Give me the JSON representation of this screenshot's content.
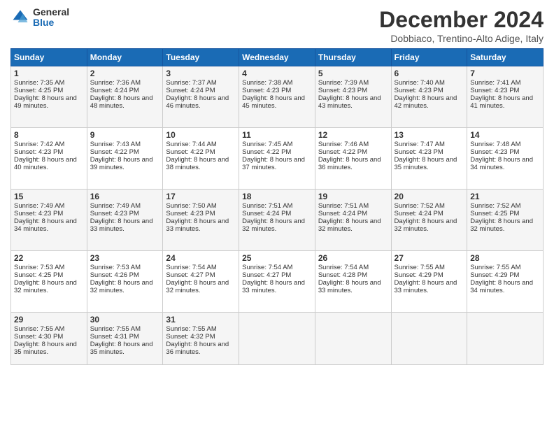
{
  "logo": {
    "general": "General",
    "blue": "Blue"
  },
  "title": "December 2024",
  "location": "Dobbiaco, Trentino-Alto Adige, Italy",
  "weekdays": [
    "Sunday",
    "Monday",
    "Tuesday",
    "Wednesday",
    "Thursday",
    "Friday",
    "Saturday"
  ],
  "weeks": [
    [
      {
        "day": "1",
        "sunrise": "7:35 AM",
        "sunset": "4:25 PM",
        "daylight": "8 hours and 49 minutes."
      },
      {
        "day": "2",
        "sunrise": "7:36 AM",
        "sunset": "4:24 PM",
        "daylight": "8 hours and 48 minutes."
      },
      {
        "day": "3",
        "sunrise": "7:37 AM",
        "sunset": "4:24 PM",
        "daylight": "8 hours and 46 minutes."
      },
      {
        "day": "4",
        "sunrise": "7:38 AM",
        "sunset": "4:23 PM",
        "daylight": "8 hours and 45 minutes."
      },
      {
        "day": "5",
        "sunrise": "7:39 AM",
        "sunset": "4:23 PM",
        "daylight": "8 hours and 43 minutes."
      },
      {
        "day": "6",
        "sunrise": "7:40 AM",
        "sunset": "4:23 PM",
        "daylight": "8 hours and 42 minutes."
      },
      {
        "day": "7",
        "sunrise": "7:41 AM",
        "sunset": "4:23 PM",
        "daylight": "8 hours and 41 minutes."
      }
    ],
    [
      {
        "day": "8",
        "sunrise": "7:42 AM",
        "sunset": "4:23 PM",
        "daylight": "8 hours and 40 minutes."
      },
      {
        "day": "9",
        "sunrise": "7:43 AM",
        "sunset": "4:22 PM",
        "daylight": "8 hours and 39 minutes."
      },
      {
        "day": "10",
        "sunrise": "7:44 AM",
        "sunset": "4:22 PM",
        "daylight": "8 hours and 38 minutes."
      },
      {
        "day": "11",
        "sunrise": "7:45 AM",
        "sunset": "4:22 PM",
        "daylight": "8 hours and 37 minutes."
      },
      {
        "day": "12",
        "sunrise": "7:46 AM",
        "sunset": "4:22 PM",
        "daylight": "8 hours and 36 minutes."
      },
      {
        "day": "13",
        "sunrise": "7:47 AM",
        "sunset": "4:23 PM",
        "daylight": "8 hours and 35 minutes."
      },
      {
        "day": "14",
        "sunrise": "7:48 AM",
        "sunset": "4:23 PM",
        "daylight": "8 hours and 34 minutes."
      }
    ],
    [
      {
        "day": "15",
        "sunrise": "7:49 AM",
        "sunset": "4:23 PM",
        "daylight": "8 hours and 34 minutes."
      },
      {
        "day": "16",
        "sunrise": "7:49 AM",
        "sunset": "4:23 PM",
        "daylight": "8 hours and 33 minutes."
      },
      {
        "day": "17",
        "sunrise": "7:50 AM",
        "sunset": "4:23 PM",
        "daylight": "8 hours and 33 minutes."
      },
      {
        "day": "18",
        "sunrise": "7:51 AM",
        "sunset": "4:24 PM",
        "daylight": "8 hours and 32 minutes."
      },
      {
        "day": "19",
        "sunrise": "7:51 AM",
        "sunset": "4:24 PM",
        "daylight": "8 hours and 32 minutes."
      },
      {
        "day": "20",
        "sunrise": "7:52 AM",
        "sunset": "4:24 PM",
        "daylight": "8 hours and 32 minutes."
      },
      {
        "day": "21",
        "sunrise": "7:52 AM",
        "sunset": "4:25 PM",
        "daylight": "8 hours and 32 minutes."
      }
    ],
    [
      {
        "day": "22",
        "sunrise": "7:53 AM",
        "sunset": "4:25 PM",
        "daylight": "8 hours and 32 minutes."
      },
      {
        "day": "23",
        "sunrise": "7:53 AM",
        "sunset": "4:26 PM",
        "daylight": "8 hours and 32 minutes."
      },
      {
        "day": "24",
        "sunrise": "7:54 AM",
        "sunset": "4:27 PM",
        "daylight": "8 hours and 32 minutes."
      },
      {
        "day": "25",
        "sunrise": "7:54 AM",
        "sunset": "4:27 PM",
        "daylight": "8 hours and 33 minutes."
      },
      {
        "day": "26",
        "sunrise": "7:54 AM",
        "sunset": "4:28 PM",
        "daylight": "8 hours and 33 minutes."
      },
      {
        "day": "27",
        "sunrise": "7:55 AM",
        "sunset": "4:29 PM",
        "daylight": "8 hours and 33 minutes."
      },
      {
        "day": "28",
        "sunrise": "7:55 AM",
        "sunset": "4:29 PM",
        "daylight": "8 hours and 34 minutes."
      }
    ],
    [
      {
        "day": "29",
        "sunrise": "7:55 AM",
        "sunset": "4:30 PM",
        "daylight": "8 hours and 35 minutes."
      },
      {
        "day": "30",
        "sunrise": "7:55 AM",
        "sunset": "4:31 PM",
        "daylight": "8 hours and 35 minutes."
      },
      {
        "day": "31",
        "sunrise": "7:55 AM",
        "sunset": "4:32 PM",
        "daylight": "8 hours and 36 minutes."
      },
      null,
      null,
      null,
      null
    ]
  ],
  "labels": {
    "sunrise": "Sunrise:",
    "sunset": "Sunset:",
    "daylight": "Daylight:"
  }
}
